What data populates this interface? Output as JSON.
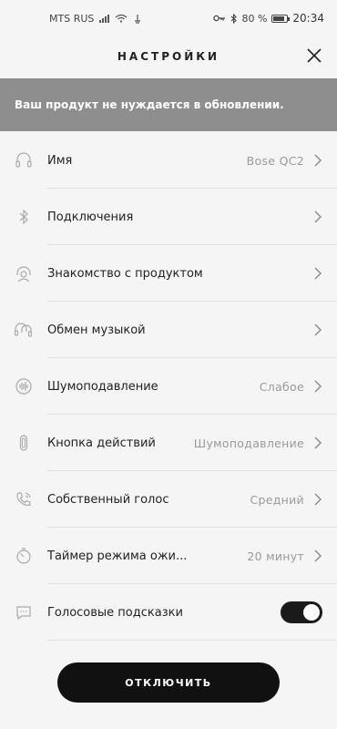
{
  "status_bar": {
    "carrier": "MTS RUS",
    "battery_percent": "80 %",
    "time": "20:34"
  },
  "header": {
    "title": "НАСТРОЙКИ"
  },
  "banner": {
    "text": "Ваш продукт не нуждается в обновлении."
  },
  "settings": {
    "items": [
      {
        "label": "Имя",
        "value": "Bose QC2",
        "icon": "headphones-icon"
      },
      {
        "label": "Подключения",
        "value": "",
        "icon": "bluetooth-icon"
      },
      {
        "label": "Знакомство с продуктом",
        "value": "",
        "icon": "headset-person-icon"
      },
      {
        "label": "Обмен музыкой",
        "value": "",
        "icon": "music-share-icon"
      },
      {
        "label": "Шумоподавление",
        "value": "Слабое",
        "icon": "noise-cancel-icon"
      },
      {
        "label": "Кнопка действий",
        "value": "Шумоподавление",
        "icon": "action-button-icon"
      },
      {
        "label": "Собственный голос",
        "value": "Средний",
        "icon": "phone-voice-icon"
      },
      {
        "label": "Таймер режима ожи...",
        "value": "20 минут",
        "icon": "timer-icon"
      },
      {
        "label": "Голосовые подсказки",
        "value": "",
        "icon": "chat-bubble-icon",
        "toggle_on": true
      }
    ]
  },
  "footer": {
    "disconnect_label": "ОТКЛЮЧИТЬ"
  },
  "colors": {
    "background": "#f5f5f5",
    "banner": "#8e8e8e",
    "button": "#111111",
    "secondary_text": "#9a9a9a"
  }
}
